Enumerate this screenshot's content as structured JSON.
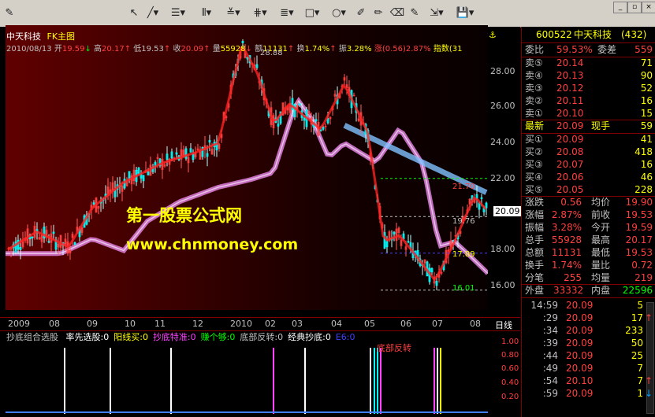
{
  "toolbar": {
    "tools": [
      "pointer",
      "line",
      "fib-lines",
      "parallel",
      "fan",
      "grid",
      "rect",
      "circle",
      "pencil",
      "eraser",
      "save"
    ],
    "window_buttons": [
      "_",
      "▫",
      "×"
    ]
  },
  "chart_header": {
    "title": "中天科技",
    "chart_name": "FK主图",
    "date": "2010/08/13",
    "open_label": "开",
    "open": "19.59",
    "high_label": "高",
    "high": "20.17",
    "low_label": "低",
    "low": "19.53",
    "close_label": "收",
    "close": "20.09",
    "volume_label": "量",
    "volume": "55928",
    "amount_label": "额",
    "amount": "11131",
    "turnover_label": "换",
    "turnover": "1.74%",
    "amplitude_label": "振",
    "amplitude": "3.28%",
    "change_label": "涨",
    "change": "(0.56)",
    "change_pct": "2.87%",
    "index_label": "指数",
    "index_val": "(31"
  },
  "watermark": {
    "line1": "第一股票公式网",
    "line2": "www.chnmoney.com"
  },
  "price_axis": [
    "28.00",
    "26.00",
    "24.00",
    "22.00",
    "20.09",
    "18.00",
    "16.00"
  ],
  "price_annotations": [
    "28.88",
    "21.70",
    "19.76",
    "17.89",
    "16.01"
  ],
  "date_axis": [
    "2009",
    "08",
    "09",
    "10",
    "11",
    "12",
    "2010",
    "02",
    "03",
    "04",
    "05",
    "06",
    "07",
    "08",
    "日线"
  ],
  "indicator": {
    "name": "抄底组合选股",
    "items": [
      {
        "label": "率先选股:",
        "value": "0",
        "color": "#ffffff"
      },
      {
        "label": "阳线买:",
        "value": "0",
        "color": "#ffff00"
      },
      {
        "label": "抄底特准:",
        "value": "0",
        "color": "#ff40ff"
      },
      {
        "label": "赚个够:",
        "value": "0",
        "color": "#00ff00"
      },
      {
        "label": "底部反转:",
        "value": "0",
        "color": "#c0c0c0"
      },
      {
        "label": "经典抄底:",
        "value": "0",
        "color": "#ffffff"
      },
      {
        "label": "E6:",
        "value": "0",
        "color": "#4040ff"
      }
    ],
    "annotation": "底部反转",
    "y_labels": [
      "1.00",
      "0.80",
      "0.60",
      "0.40",
      "0.20"
    ]
  },
  "quote": {
    "code": "600522",
    "name": "中天科技",
    "suffix": "(432)",
    "webi_label": "委比",
    "webi": "59.53%",
    "weicha_label": "委差",
    "weicha": "559",
    "asks": [
      {
        "label": "卖⑤",
        "price": "20.14",
        "vol": "71"
      },
      {
        "label": "卖④",
        "price": "20.13",
        "vol": "90"
      },
      {
        "label": "卖③",
        "price": "20.12",
        "vol": "52"
      },
      {
        "label": "卖②",
        "price": "20.11",
        "vol": "16"
      },
      {
        "label": "卖①",
        "price": "20.10",
        "vol": "15"
      }
    ],
    "last_label": "最新",
    "last": "20.09",
    "xianshou_label": "现手",
    "xianshou": "59",
    "bids": [
      {
        "label": "买①",
        "price": "20.09",
        "vol": "41"
      },
      {
        "label": "买②",
        "price": "20.08",
        "vol": "418"
      },
      {
        "label": "买③",
        "price": "20.07",
        "vol": "16"
      },
      {
        "label": "买④",
        "price": "20.06",
        "vol": "46"
      },
      {
        "label": "买⑤",
        "price": "20.05",
        "vol": "228"
      }
    ],
    "stats": [
      {
        "l1": "涨跌",
        "v1": "0.56",
        "l2": "均价",
        "v2": "19.90"
      },
      {
        "l1": "涨幅",
        "v1": "2.87%",
        "l2": "前收",
        "v2": "19.53"
      },
      {
        "l1": "振幅",
        "v1": "3.28%",
        "l2": "今开",
        "v2": "19.59"
      },
      {
        "l1": "总手",
        "v1": "55928",
        "l2": "最高",
        "v2": "20.17"
      },
      {
        "l1": "总额",
        "v1": "11131",
        "l2": "最低",
        "v2": "19.53"
      },
      {
        "l1": "换手",
        "v1": "1.74%",
        "l2": "量比",
        "v2": "0.72"
      },
      {
        "l1": "分笔",
        "v1": "255",
        "l2": "均量",
        "v2": "219"
      }
    ],
    "outer_label": "外盘",
    "outer": "33332",
    "inner_label": "内盘",
    "inner": "22596",
    "ticks": [
      {
        "time": "14:59",
        "price": "20.09",
        "vol": "5",
        "dir": ""
      },
      {
        "time": ":29",
        "price": "20.09",
        "vol": "17",
        "dir": "up"
      },
      {
        "time": ":34",
        "price": "20.09",
        "vol": "233",
        "dir": ""
      },
      {
        "time": ":39",
        "price": "20.09",
        "vol": "50",
        "dir": ""
      },
      {
        "time": ":44",
        "price": "20.09",
        "vol": "25",
        "dir": ""
      },
      {
        "time": ":49",
        "price": "20.09",
        "vol": "7",
        "dir": ""
      },
      {
        "time": ":54",
        "price": "20.10",
        "vol": "7",
        "dir": "up"
      },
      {
        "time": ":59",
        "price": "20.09",
        "vol": "1",
        "dir": "down"
      }
    ]
  }
}
